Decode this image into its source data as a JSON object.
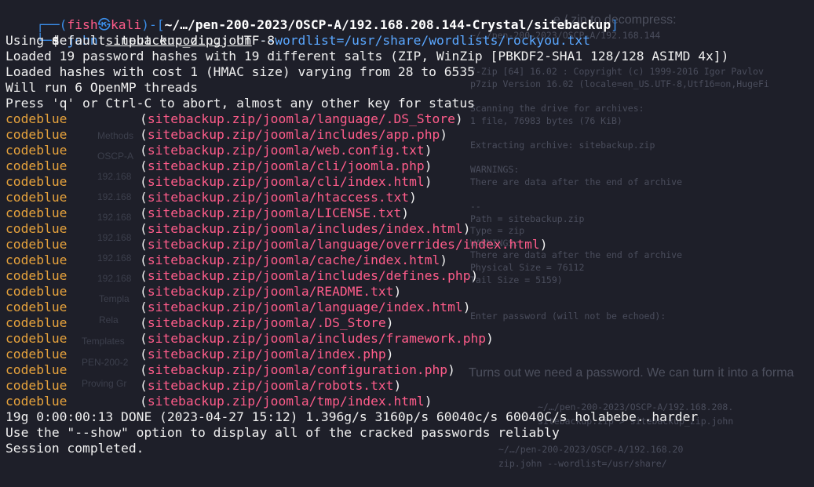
{
  "prompt": {
    "user": "fish",
    "sep": "㉿",
    "host": "kali",
    "path": "~/…/pen-200-2023/OSCP-A/192.168.208.144-Crystal/sitebackup",
    "symbol": "$"
  },
  "command": {
    "program": "john",
    "target": "sitebackup_zip.john",
    "option": "--wordlist=/usr/share/wordlists/rockyou.txt"
  },
  "header_lines": [
    "Using default input encoding: UTF-8",
    "Loaded 19 password hashes with 19 different salts (ZIP, WinZip [PBKDF2-SHA1 128/128 ASIMD 4x])",
    "Loaded hashes with cost 1 (HMAC size) varying from 28 to 6535",
    "Will run 6 OpenMP threads",
    "Press 'q' or Ctrl-C to abort, almost any other key for status"
  ],
  "cracked": [
    {
      "password": "codeblue",
      "file": "sitebackup.zip/joomla/language/.DS_Store"
    },
    {
      "password": "codeblue",
      "file": "sitebackup.zip/joomla/includes/app.php"
    },
    {
      "password": "codeblue",
      "file": "sitebackup.zip/joomla/web.config.txt"
    },
    {
      "password": "codeblue",
      "file": "sitebackup.zip/joomla/cli/joomla.php"
    },
    {
      "password": "codeblue",
      "file": "sitebackup.zip/joomla/cli/index.html"
    },
    {
      "password": "codeblue",
      "file": "sitebackup.zip/joomla/htaccess.txt"
    },
    {
      "password": "codeblue",
      "file": "sitebackup.zip/joomla/LICENSE.txt"
    },
    {
      "password": "codeblue",
      "file": "sitebackup.zip/joomla/includes/index.html"
    },
    {
      "password": "codeblue",
      "file": "sitebackup.zip/joomla/language/overrides/index.html"
    },
    {
      "password": "codeblue",
      "file": "sitebackup.zip/joomla/cache/index.html"
    },
    {
      "password": "codeblue",
      "file": "sitebackup.zip/joomla/includes/defines.php"
    },
    {
      "password": "codeblue",
      "file": "sitebackup.zip/joomla/README.txt"
    },
    {
      "password": "codeblue",
      "file": "sitebackup.zip/joomla/language/index.html"
    },
    {
      "password": "codeblue",
      "file": "sitebackup.zip/joomla/.DS_Store"
    },
    {
      "password": "codeblue",
      "file": "sitebackup.zip/joomla/includes/framework.php"
    },
    {
      "password": "codeblue",
      "file": "sitebackup.zip/joomla/index.php"
    },
    {
      "password": "codeblue",
      "file": "sitebackup.zip/joomla/configuration.php"
    },
    {
      "password": "codeblue",
      "file": "sitebackup.zip/joomla/robots.txt"
    },
    {
      "password": "codeblue",
      "file": "sitebackup.zip/joomla/tmp/index.html"
    }
  ],
  "footer_lines": [
    "19g 0:00:00:13 DONE (2023-04-27 15:12) 1.396g/s 3160p/s 60040c/s 60040C/s holabebe..harder",
    "Use the \"--show\" option to display all of the cracked passwords reliably",
    "Session completed."
  ],
  "background_window": {
    "lines": [
      "e / zip to decompress:",
      "~/…/pen-200-2023/OSCP-A/192.168.144",
      "",
      "",
      "7-Zip [64] 16.02 : Copyright (c) 1999-2016 Igor Pavlov",
      "p7zip Version 16.02 (locale=en_US.UTF-8,Utf16=on,HugeFi",
      "",
      "Scanning the drive for archives:",
      "1 file, 76983 bytes (76 KiB)",
      "",
      "Extracting archive: sitebackup.zip",
      "",
      "WARNINGS:",
      "There are data after the end of archive",
      "",
      "--",
      "Path = sitebackup.zip",
      "Type = zip",
      "WARNINGS:",
      "There are data after the end of archive",
      "Physical Size = 76112",
      "Tail Size = 5159)",
      "",
      "",
      "Enter password (will not be echoed):",
      "",
      "",
      "",
      "",
      "",
      "",
      "",
      "",
      "",
      "",
      "",
      "",
      "",
      "",
      "",
      "",
      ""
    ],
    "caption": "Turns out we need a password. We can turn it into a forma",
    "lower_lines": [
      "~/…/pen-200-2023/OSCP-A/192.168.208.",
      "sitebackup.zip > sitebackup_zip.john",
      "",
      "~/…/pen-200-2023/OSCP-A/192.168.20",
      "zip.john --wordlist=/usr/share/"
    ],
    "sidebar_items": [
      "Methods",
      "OSCP-A",
      "192.168",
      "192.168",
      "192.168",
      "192.168",
      "192.168",
      "192.168",
      "Templa",
      "Rela",
      "Templates",
      "PEN-200-2",
      "Proving Gr"
    ]
  }
}
